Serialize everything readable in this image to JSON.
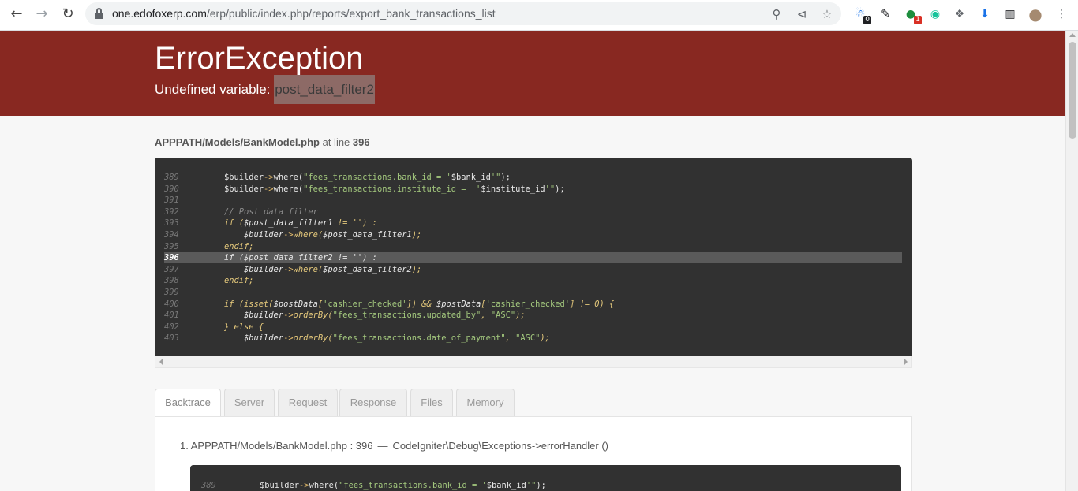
{
  "browser": {
    "url_host": "one.edofoxerp.com",
    "url_path": "/erp/public/index.php/reports/export_bank_transactions_list",
    "nav_icons": [
      "back-arrow-icon",
      "forward-arrow-icon",
      "reload-icon"
    ],
    "omnibox_icons": [
      "zoom-icon",
      "share-icon",
      "bookmark-star-icon"
    ],
    "extensions": [
      {
        "name": "ghost-extension-icon",
        "badge": "0",
        "badge_color": "#202124",
        "color": "#1a73e8"
      },
      {
        "name": "eyedropper-extension-icon",
        "badge": "",
        "badge_color": "",
        "color": "#202124"
      },
      {
        "name": "green-extension-icon",
        "badge": "1",
        "badge_color": "#d93025",
        "color": "#1e8e3e"
      },
      {
        "name": "grammarly-extension-icon",
        "badge": "",
        "badge_color": "",
        "color": "#15c39a"
      },
      {
        "name": "puzzle-extensions-icon",
        "badge": "",
        "badge_color": "",
        "color": "#5f6368"
      },
      {
        "name": "download-icon",
        "badge": "",
        "badge_color": "",
        "color": "#1a73e8"
      },
      {
        "name": "side-panel-icon",
        "badge": "",
        "badge_color": "",
        "color": "#202124"
      },
      {
        "name": "profile-avatar",
        "badge": "",
        "badge_color": "",
        "color": "#a58a70"
      },
      {
        "name": "kebab-menu-icon",
        "badge": "",
        "badge_color": "",
        "color": "#5f6368"
      }
    ]
  },
  "error": {
    "title": "ErrorException",
    "message_prefix": "Undefined variable: ",
    "variable": "post_data_filter2",
    "header_color": "#882821"
  },
  "location": {
    "file": "APPPATH/Models/BankModel.php",
    "at_line_text": " at line ",
    "line": "396"
  },
  "source": {
    "highlight_line": "396",
    "lines": [
      {
        "num": "389",
        "tokens": [
          [
            "plain",
            "$builder"
          ],
          [
            "op",
            "->"
          ],
          [
            "plain",
            "where("
          ],
          [
            "str",
            "\"fees_transactions.bank_id = '"
          ],
          [
            "plain",
            "$bank_id"
          ],
          [
            "str",
            "'\""
          ],
          [
            "plain",
            ");"
          ]
        ]
      },
      {
        "num": "390",
        "tokens": [
          [
            "plain",
            "$builder"
          ],
          [
            "op",
            "->"
          ],
          [
            "plain",
            "where("
          ],
          [
            "str",
            "\"fees_transactions.institute_id =  '"
          ],
          [
            "plain",
            "$institute_id"
          ],
          [
            "str",
            "'\""
          ],
          [
            "plain",
            ");"
          ]
        ]
      },
      {
        "num": "391",
        "tokens": []
      },
      {
        "num": "392",
        "tokens": [
          [
            "com",
            "// Post data filter"
          ]
        ]
      },
      {
        "num": "393",
        "tokens": [
          [
            "kw",
            "if ("
          ],
          [
            "var",
            "$post_data_filter1"
          ],
          [
            "kw",
            " != '') :"
          ]
        ]
      },
      {
        "num": "394",
        "tokens": [
          [
            "var",
            "    $builder"
          ],
          [
            "op",
            "->"
          ],
          [
            "kw",
            "where("
          ],
          [
            "var",
            "$post_data_filter1"
          ],
          [
            "kw",
            ");"
          ]
        ]
      },
      {
        "num": "395",
        "tokens": [
          [
            "kw",
            "endif;"
          ]
        ]
      },
      {
        "num": "396",
        "tokens": [
          [
            "plain",
            "if ($post_data_filter2 != '') :"
          ]
        ]
      },
      {
        "num": "397",
        "tokens": [
          [
            "var",
            "    $builder"
          ],
          [
            "op",
            "->"
          ],
          [
            "kw",
            "where("
          ],
          [
            "var",
            "$post_data_filter2"
          ],
          [
            "kw",
            ");"
          ]
        ]
      },
      {
        "num": "398",
        "tokens": [
          [
            "kw",
            "endif;"
          ]
        ]
      },
      {
        "num": "399",
        "tokens": []
      },
      {
        "num": "400",
        "tokens": [
          [
            "kw",
            "if (isset("
          ],
          [
            "var",
            "$postData"
          ],
          [
            "kw",
            "["
          ],
          [
            "str",
            "'cashier_checked'"
          ],
          [
            "kw",
            "]) && "
          ],
          [
            "var",
            "$postData"
          ],
          [
            "kw",
            "["
          ],
          [
            "str",
            "'cashier_checked'"
          ],
          [
            "kw",
            "] != 0) {"
          ]
        ]
      },
      {
        "num": "401",
        "tokens": [
          [
            "var",
            "    $builder"
          ],
          [
            "op",
            "->"
          ],
          [
            "kw",
            "orderBy("
          ],
          [
            "str",
            "\"fees_transactions.updated_by\""
          ],
          [
            "kw",
            ", "
          ],
          [
            "str",
            "\"ASC\""
          ],
          [
            "kw",
            ");"
          ]
        ]
      },
      {
        "num": "402",
        "tokens": [
          [
            "kw",
            "} else {"
          ]
        ]
      },
      {
        "num": "403",
        "tokens": [
          [
            "var",
            "    $builder"
          ],
          [
            "op",
            "->"
          ],
          [
            "kw",
            "orderBy("
          ],
          [
            "str",
            "\"fees_transactions.date_of_payment\""
          ],
          [
            "kw",
            ", "
          ],
          [
            "str",
            "\"ASC\""
          ],
          [
            "kw",
            ");"
          ]
        ]
      }
    ]
  },
  "tabs": [
    {
      "label": "Backtrace",
      "active": true
    },
    {
      "label": "Server",
      "active": false
    },
    {
      "label": "Request",
      "active": false
    },
    {
      "label": "Response",
      "active": false
    },
    {
      "label": "Files",
      "active": false
    },
    {
      "label": "Memory",
      "active": false
    }
  ],
  "backtrace": {
    "index": "1.",
    "file": "APPPATH/Models/BankModel.php : 396",
    "separator": "—",
    "call": "CodeIgniter\\Debug\\Exceptions->errorHandler ()",
    "preview_line": {
      "num": "389",
      "tokens": [
        [
          "plain",
          "$builder"
        ],
        [
          "op",
          "->"
        ],
        [
          "plain",
          "where("
        ],
        [
          "str",
          "\"fees_transactions.bank_id = '"
        ],
        [
          "plain",
          "$bank_id"
        ],
        [
          "str",
          "'\""
        ],
        [
          "plain",
          ");"
        ]
      ]
    }
  }
}
